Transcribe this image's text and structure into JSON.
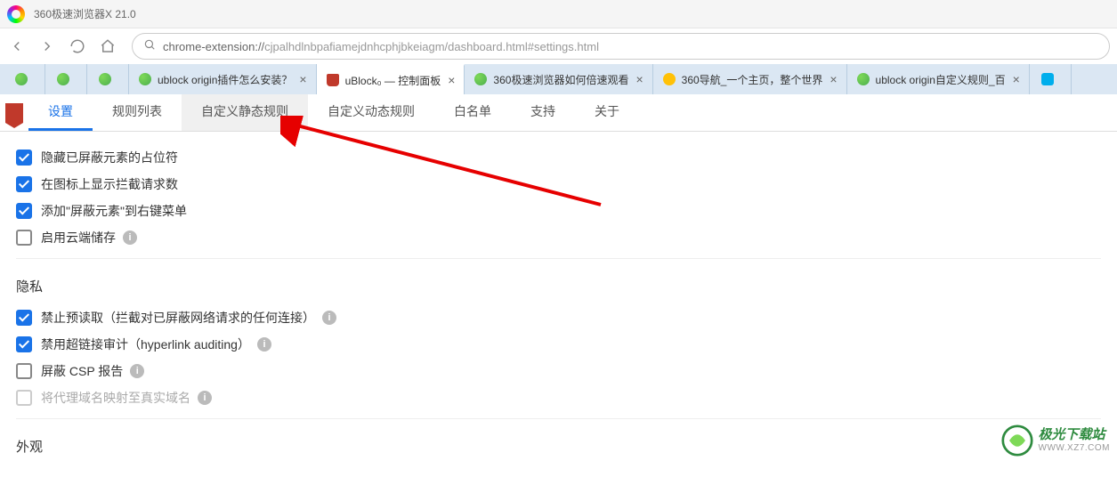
{
  "app": {
    "title": "360极速浏览器X 21.0"
  },
  "address": {
    "protocol": "chrome-extension://",
    "path": "cjpalhdlnbpafiamejdnhcphjbkeiagm/dashboard.html#settings.html"
  },
  "tabs": {
    "plugin": "ublock origin插件怎么安装？",
    "dashboard": "uBlock₀ — 控制面板",
    "speed": "360极速浏览器如何倍速观看",
    "nav360": "360导航_一个主页，整个世界",
    "custom": "ublock origin自定义规则_百"
  },
  "dash_tabs": {
    "settings": "设置",
    "filters": "规则列表",
    "static_rules": "自定义静态规则",
    "dynamic_rules": "自定义动态规则",
    "whitelist": "白名单",
    "support": "支持",
    "about": "关于"
  },
  "options": {
    "placeholder": "隐藏已屏蔽元素的占位符",
    "badge_count": "在图标上显示拦截请求数",
    "context_menu": "添加\"屏蔽元素\"到右键菜单",
    "cloud_storage": "启用云端储存"
  },
  "privacy": {
    "title": "隐私",
    "prefetch": "禁止预读取（拦截对已屏蔽网络请求的任何连接）",
    "hyperlink": "禁用超链接审计（hyperlink auditing）",
    "csp": "屏蔽 CSP 报告",
    "proxy_domain": "将代理域名映射至真实域名"
  },
  "appearance": {
    "title": "外观"
  },
  "watermark": {
    "main": "极光下载站",
    "sub": "WWW.XZ7.COM"
  }
}
